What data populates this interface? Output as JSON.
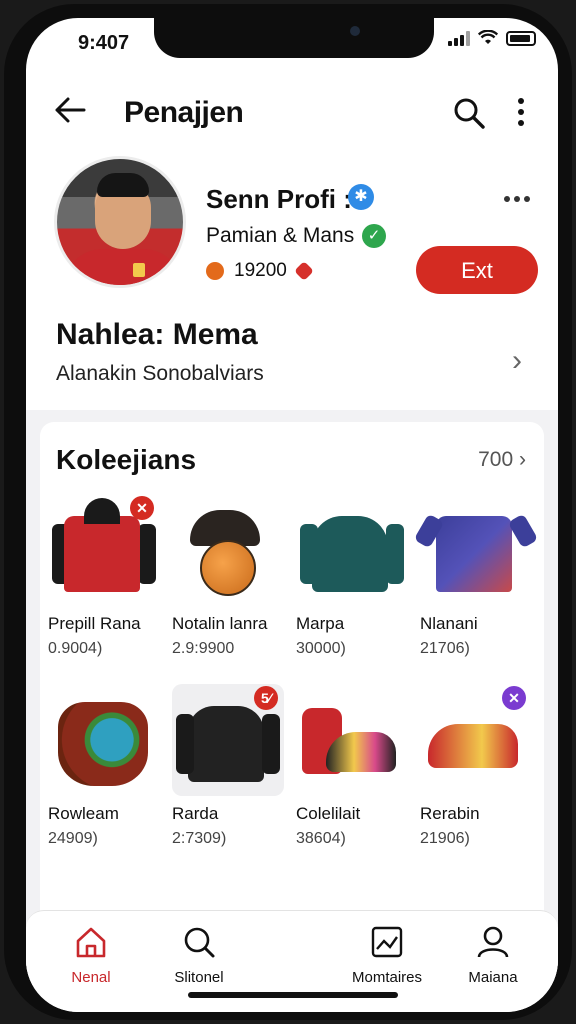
{
  "status": {
    "time": "9:407"
  },
  "header": {
    "title": "Penajjen"
  },
  "profile": {
    "name": "Senn Profi :",
    "subtitle": "Pamian & Mans",
    "stats": "19200",
    "action_label": "Ext"
  },
  "info": {
    "title": "Nahlea: Mema",
    "subtitle": "Alanakin Sonobalviars"
  },
  "collection": {
    "title": "Koleejians",
    "count": "700",
    "items": [
      {
        "name": "Prepill Rana",
        "price": "0.9004)",
        "badge": "✕"
      },
      {
        "name": "Notalin lanra",
        "price": "2.9:9900",
        "badge": ""
      },
      {
        "name": "Marpa",
        "price": "30000)",
        "badge": ""
      },
      {
        "name": "Nlanani",
        "price": "21706)",
        "badge": ""
      },
      {
        "name": "Rowleam",
        "price": "24909)",
        "badge": ""
      },
      {
        "name": "Rarda",
        "price": "2:7309)",
        "badge": "5⁄"
      },
      {
        "name": "Colelilait",
        "price": "38604)",
        "badge": ""
      },
      {
        "name": "Rerabin",
        "price": "21906)",
        "badge": "✕"
      }
    ]
  },
  "tabs": [
    {
      "label": "Nenal",
      "icon": "home-icon"
    },
    {
      "label": "Slitonel",
      "icon": "search-icon"
    },
    {
      "label": "Momtaires",
      "icon": "chart-icon"
    },
    {
      "label": "Maiana",
      "icon": "user-icon"
    }
  ],
  "colors": {
    "accent": "#d42b22",
    "verify_blue": "#2f8be6",
    "verify_green": "#2ea64d"
  }
}
